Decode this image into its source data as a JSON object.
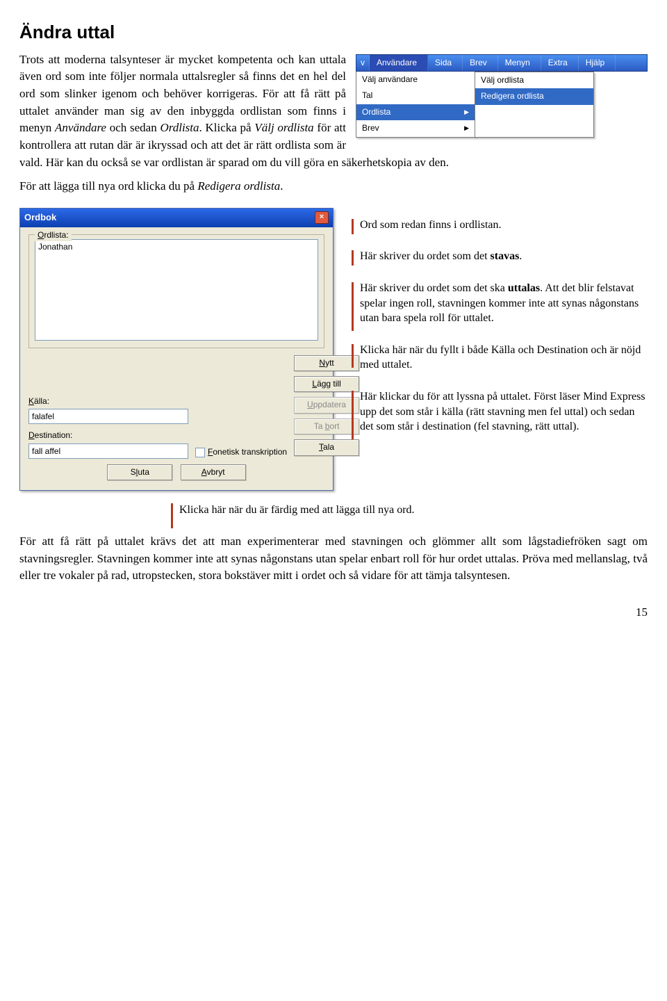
{
  "heading": "Ändra uttal",
  "para1_a": "Trots att moderna talsynteser är mycket kompetenta och kan uttala även ord som inte följer normala uttalsregler så finns det en hel del ord som slinker igenom och behöver korrigeras. För att få rätt på uttalet använder",
  "para1_b_pre": "man sig av den inbyggda ordlistan som finns i menyn ",
  "para1_b_anv": "Användare",
  "para1_b_mid": " och sedan ",
  "para1_b_ord": "Ordlista",
  "para1_b_post": ". Klicka på ",
  "para1_b_valj": "Välj ordlista",
  "para1_c": " för att kontrollera att rutan där är ikryssad och att det är rätt ordlista som är vald. Här kan du också se var ordlistan är sparad om du vill göra en säkerhetskopia av den.",
  "para2_pre": "För att lägga till nya ord klicka du på ",
  "para2_red": "Redigera ordlista",
  "para2_post": ".",
  "menubar": {
    "v": "v",
    "anvandare": "Användare",
    "sida": "Sida",
    "brev": "Brev",
    "menyn": "Menyn",
    "extra": "Extra",
    "hjalp": "Hjälp"
  },
  "dropdown": {
    "valj_anv": "Välj användare",
    "tal": "Tal",
    "ordlista": "Ordlista",
    "brev": "Brev"
  },
  "submenu": {
    "valj_ord": "Välj ordlista",
    "redigera_ord": "Redigera ordlista"
  },
  "dialog": {
    "title": "Ordbok",
    "group_ordlista": "Ordlista:",
    "list_item": "Jonathan",
    "kalla_label": "Källa:",
    "kalla_value": "falafel",
    "dest_label": "Destination:",
    "dest_value": "fall affel",
    "fonetisk": "Fonetisk transkription",
    "btn_nytt": "Nytt",
    "btn_laggtill": "Lägg till",
    "btn_uppdatera": "Uppdatera",
    "btn_tabort": "Ta bort",
    "btn_tala": "Tala",
    "btn_sluta": "Sluta",
    "btn_avbryt": "Avbryt"
  },
  "callouts": {
    "c1": "Ord som redan finns i ordlistan.",
    "c2_a": "Här skriver du ordet som det ",
    "c2_b": "stavas",
    "c2_c": ".",
    "c3_a": "Här skriver du ordet som det ska ",
    "c3_b": "uttalas",
    "c3_c": ". Att det blir felstavat spelar ingen roll, stavningen kommer inte att synas någonstans utan bara spela roll för uttalet.",
    "c4": "Klicka här när du fyllt i både Källa och Destination och är nöjd med uttalet.",
    "c5": "Här klickar du för att lyssna på uttalet. Först läser Mind Express upp det som står i källa (rätt stavning men fel uttal) och sedan det som står i destination (fel stavning, rätt uttal).",
    "below": "Klicka här när du är färdig med att lägga till nya ord."
  },
  "para3": "För att få rätt på uttalet krävs det att man experimenterar med stavningen och glömmer allt som lågstadiefröken sagt om stavningsregler. Stavningen kommer inte att synas någonstans utan spelar enbart roll för hur ordet uttalas. Pröva med mellanslag, två eller tre vokaler på rad, utropstecken, stora bokstäver mitt i ordet och så vidare för att tämja talsyntesen.",
  "page_number": "15"
}
